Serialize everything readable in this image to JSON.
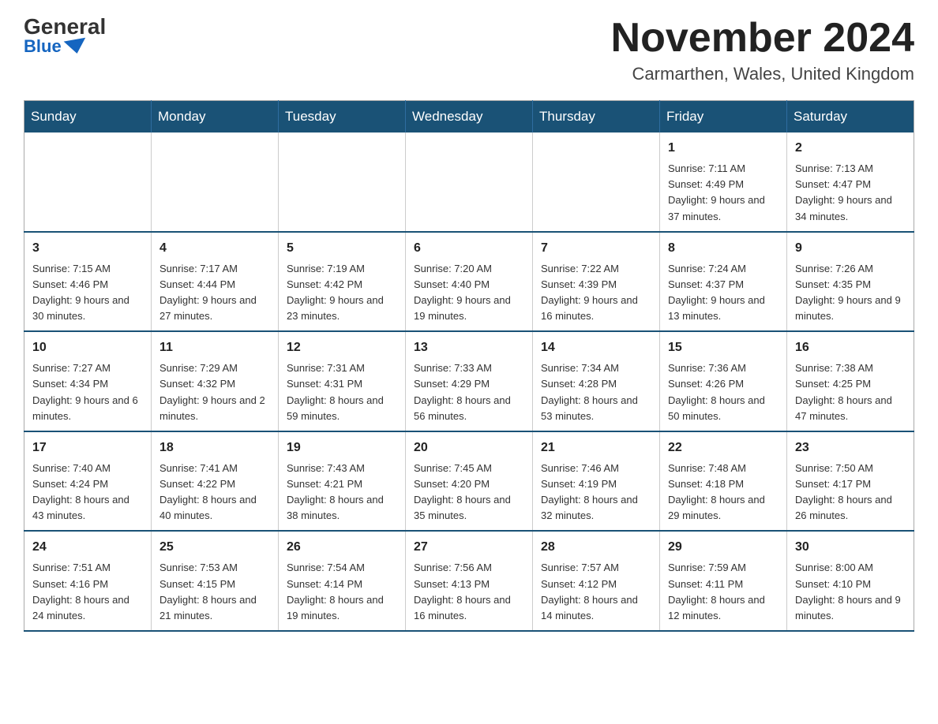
{
  "header": {
    "logo_general": "General",
    "logo_blue": "Blue",
    "month_title": "November 2024",
    "location": "Carmarthen, Wales, United Kingdom"
  },
  "weekdays": [
    "Sunday",
    "Monday",
    "Tuesday",
    "Wednesday",
    "Thursday",
    "Friday",
    "Saturday"
  ],
  "weeks": [
    [
      {
        "day": "",
        "info": ""
      },
      {
        "day": "",
        "info": ""
      },
      {
        "day": "",
        "info": ""
      },
      {
        "day": "",
        "info": ""
      },
      {
        "day": "",
        "info": ""
      },
      {
        "day": "1",
        "info": "Sunrise: 7:11 AM\nSunset: 4:49 PM\nDaylight: 9 hours\nand 37 minutes."
      },
      {
        "day": "2",
        "info": "Sunrise: 7:13 AM\nSunset: 4:47 PM\nDaylight: 9 hours\nand 34 minutes."
      }
    ],
    [
      {
        "day": "3",
        "info": "Sunrise: 7:15 AM\nSunset: 4:46 PM\nDaylight: 9 hours\nand 30 minutes."
      },
      {
        "day": "4",
        "info": "Sunrise: 7:17 AM\nSunset: 4:44 PM\nDaylight: 9 hours\nand 27 minutes."
      },
      {
        "day": "5",
        "info": "Sunrise: 7:19 AM\nSunset: 4:42 PM\nDaylight: 9 hours\nand 23 minutes."
      },
      {
        "day": "6",
        "info": "Sunrise: 7:20 AM\nSunset: 4:40 PM\nDaylight: 9 hours\nand 19 minutes."
      },
      {
        "day": "7",
        "info": "Sunrise: 7:22 AM\nSunset: 4:39 PM\nDaylight: 9 hours\nand 16 minutes."
      },
      {
        "day": "8",
        "info": "Sunrise: 7:24 AM\nSunset: 4:37 PM\nDaylight: 9 hours\nand 13 minutes."
      },
      {
        "day": "9",
        "info": "Sunrise: 7:26 AM\nSunset: 4:35 PM\nDaylight: 9 hours\nand 9 minutes."
      }
    ],
    [
      {
        "day": "10",
        "info": "Sunrise: 7:27 AM\nSunset: 4:34 PM\nDaylight: 9 hours\nand 6 minutes."
      },
      {
        "day": "11",
        "info": "Sunrise: 7:29 AM\nSunset: 4:32 PM\nDaylight: 9 hours\nand 2 minutes."
      },
      {
        "day": "12",
        "info": "Sunrise: 7:31 AM\nSunset: 4:31 PM\nDaylight: 8 hours\nand 59 minutes."
      },
      {
        "day": "13",
        "info": "Sunrise: 7:33 AM\nSunset: 4:29 PM\nDaylight: 8 hours\nand 56 minutes."
      },
      {
        "day": "14",
        "info": "Sunrise: 7:34 AM\nSunset: 4:28 PM\nDaylight: 8 hours\nand 53 minutes."
      },
      {
        "day": "15",
        "info": "Sunrise: 7:36 AM\nSunset: 4:26 PM\nDaylight: 8 hours\nand 50 minutes."
      },
      {
        "day": "16",
        "info": "Sunrise: 7:38 AM\nSunset: 4:25 PM\nDaylight: 8 hours\nand 47 minutes."
      }
    ],
    [
      {
        "day": "17",
        "info": "Sunrise: 7:40 AM\nSunset: 4:24 PM\nDaylight: 8 hours\nand 43 minutes."
      },
      {
        "day": "18",
        "info": "Sunrise: 7:41 AM\nSunset: 4:22 PM\nDaylight: 8 hours\nand 40 minutes."
      },
      {
        "day": "19",
        "info": "Sunrise: 7:43 AM\nSunset: 4:21 PM\nDaylight: 8 hours\nand 38 minutes."
      },
      {
        "day": "20",
        "info": "Sunrise: 7:45 AM\nSunset: 4:20 PM\nDaylight: 8 hours\nand 35 minutes."
      },
      {
        "day": "21",
        "info": "Sunrise: 7:46 AM\nSunset: 4:19 PM\nDaylight: 8 hours\nand 32 minutes."
      },
      {
        "day": "22",
        "info": "Sunrise: 7:48 AM\nSunset: 4:18 PM\nDaylight: 8 hours\nand 29 minutes."
      },
      {
        "day": "23",
        "info": "Sunrise: 7:50 AM\nSunset: 4:17 PM\nDaylight: 8 hours\nand 26 minutes."
      }
    ],
    [
      {
        "day": "24",
        "info": "Sunrise: 7:51 AM\nSunset: 4:16 PM\nDaylight: 8 hours\nand 24 minutes."
      },
      {
        "day": "25",
        "info": "Sunrise: 7:53 AM\nSunset: 4:15 PM\nDaylight: 8 hours\nand 21 minutes."
      },
      {
        "day": "26",
        "info": "Sunrise: 7:54 AM\nSunset: 4:14 PM\nDaylight: 8 hours\nand 19 minutes."
      },
      {
        "day": "27",
        "info": "Sunrise: 7:56 AM\nSunset: 4:13 PM\nDaylight: 8 hours\nand 16 minutes."
      },
      {
        "day": "28",
        "info": "Sunrise: 7:57 AM\nSunset: 4:12 PM\nDaylight: 8 hours\nand 14 minutes."
      },
      {
        "day": "29",
        "info": "Sunrise: 7:59 AM\nSunset: 4:11 PM\nDaylight: 8 hours\nand 12 minutes."
      },
      {
        "day": "30",
        "info": "Sunrise: 8:00 AM\nSunset: 4:10 PM\nDaylight: 8 hours\nand 9 minutes."
      }
    ]
  ]
}
